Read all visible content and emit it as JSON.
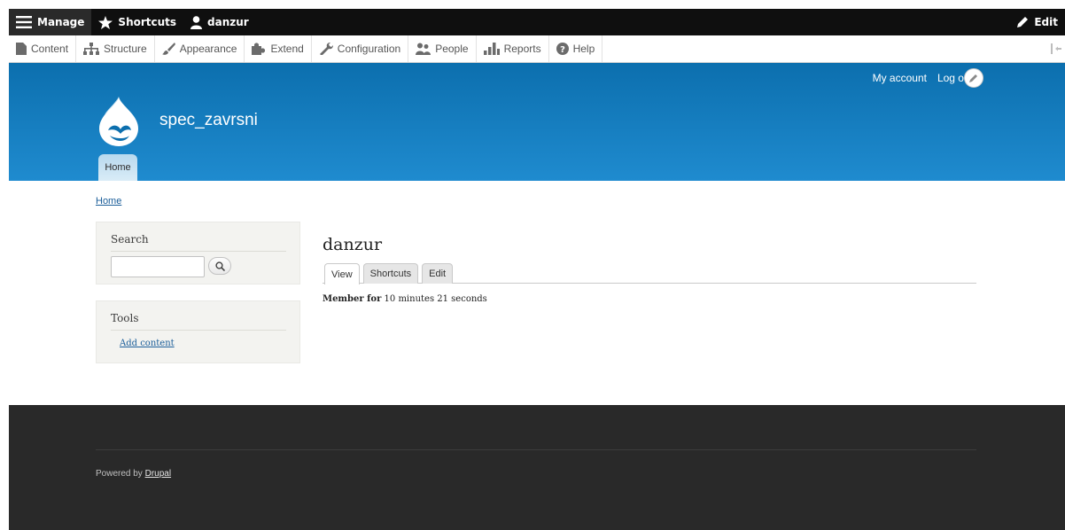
{
  "toolbar": {
    "manage_label": "Manage",
    "shortcuts_label": "Shortcuts",
    "user_label": "danzur",
    "edit_label": "Edit"
  },
  "tray": {
    "items": [
      {
        "label": "Content",
        "icon": "file-icon"
      },
      {
        "label": "Structure",
        "icon": "sitemap-icon"
      },
      {
        "label": "Appearance",
        "icon": "paintbrush-icon"
      },
      {
        "label": "Extend",
        "icon": "puzzle-icon"
      },
      {
        "label": "Configuration",
        "icon": "wrench-icon"
      },
      {
        "label": "People",
        "icon": "people-icon"
      },
      {
        "label": "Reports",
        "icon": "bar-chart-icon"
      },
      {
        "label": "Help",
        "icon": "help-icon"
      }
    ]
  },
  "header": {
    "my_account": "My account",
    "log_out": "Log out",
    "site_name": "spec_zavrsni",
    "primary_tab": "Home"
  },
  "breadcrumb": {
    "home": "Home"
  },
  "sidebar": {
    "search_title": "Search",
    "tools_title": "Tools",
    "add_content": "Add content"
  },
  "main": {
    "title": "danzur",
    "tabs": [
      {
        "label": "View",
        "active": true
      },
      {
        "label": "Shortcuts",
        "active": false
      },
      {
        "label": "Edit",
        "active": false
      }
    ],
    "member_label": "Member for",
    "member_value": "10 minutes 21 seconds"
  },
  "footer": {
    "powered_prefix": "Powered by",
    "powered_link": "Drupal"
  },
  "colors": {
    "toolbar_bg": "#0f0f0f",
    "header_top": "#0c6fae",
    "header_bottom": "#1f8bcf",
    "link": "#1a5d99",
    "footer_bg": "#292929"
  }
}
